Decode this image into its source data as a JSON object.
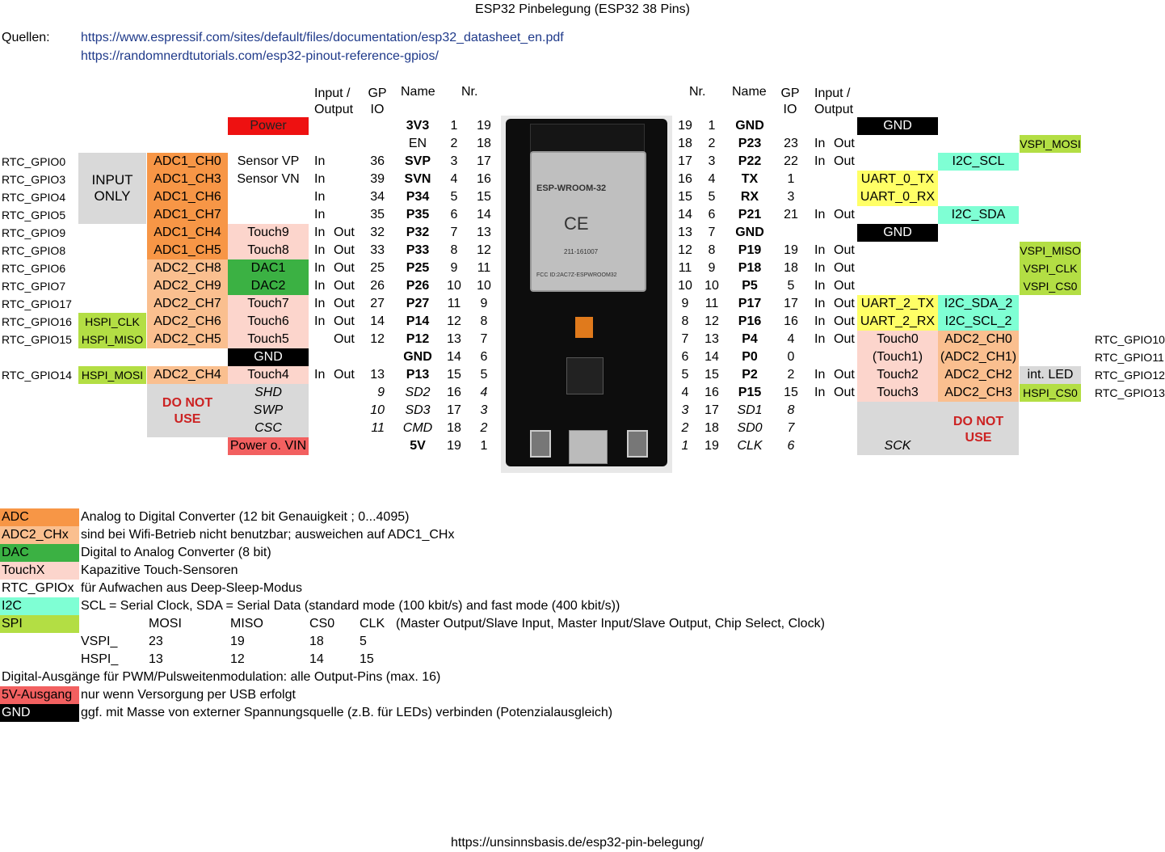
{
  "title": "ESP32 Pinbelegung (ESP32 38 Pins)",
  "sources": {
    "label": "Quellen:",
    "links": [
      "https://www.espressif.com/sites/default/files/documentation/esp32_datasheet_en.pdf",
      "https://randomnerdtutorials.com/esp32-pinout-reference-gpios/"
    ]
  },
  "headers": {
    "io": "Input /",
    "io2": "Output",
    "gp": "GP",
    "gp2": "IO",
    "name": "Name",
    "nr": "Nr."
  },
  "left": {
    "power": "Power",
    "input_only": [
      "INPUT",
      "ONLY"
    ],
    "do_not_use": [
      "DO NOT",
      "USE"
    ],
    "gnd": "GND",
    "power_vin": "Power o. VIN",
    "rows": [
      {
        "rtc": "",
        "spi": "",
        "adc": "",
        "func": "",
        "io": "",
        "gpio": "",
        "name": "3V3",
        "nr": "1",
        "nr2": "19"
      },
      {
        "rtc": "",
        "spi": "",
        "adc": "",
        "func": "",
        "io": "",
        "gpio": "",
        "name": "EN",
        "nr": "2",
        "nr2": "18"
      },
      {
        "rtc": "RTC_GPIO0",
        "spi": "",
        "adc": "ADC1_CH0",
        "func": "Sensor VP",
        "io": "In",
        "out": "",
        "gpio": "36",
        "name": "SVP",
        "nr": "3",
        "nr2": "17"
      },
      {
        "rtc": "RTC_GPIO3",
        "spi": "",
        "adc": "ADC1_CH3",
        "func": "Sensor VN",
        "io": "In",
        "out": "",
        "gpio": "39",
        "name": "SVN",
        "nr": "4",
        "nr2": "16"
      },
      {
        "rtc": "RTC_GPIO4",
        "spi": "",
        "adc": "ADC1_CH6",
        "func": "",
        "io": "In",
        "out": "",
        "gpio": "34",
        "name": "P34",
        "nr": "5",
        "nr2": "15"
      },
      {
        "rtc": "RTC_GPIO5",
        "spi": "",
        "adc": "ADC1_CH7",
        "func": "",
        "io": "In",
        "out": "",
        "gpio": "35",
        "name": "P35",
        "nr": "6",
        "nr2": "14"
      },
      {
        "rtc": "RTC_GPIO9",
        "spi": "",
        "adc": "ADC1_CH4",
        "func": "Touch9",
        "io": "In",
        "out": "Out",
        "gpio": "32",
        "name": "P32",
        "nr": "7",
        "nr2": "13"
      },
      {
        "rtc": "RTC_GPIO8",
        "spi": "",
        "adc": "ADC1_CH5",
        "func": "Touch8",
        "io": "In",
        "out": "Out",
        "gpio": "33",
        "name": "P33",
        "nr": "8",
        "nr2": "12"
      },
      {
        "rtc": "RTC_GPIO6",
        "spi": "",
        "adc": "ADC2_CH8",
        "func": "DAC1",
        "io": "In",
        "out": "Out",
        "gpio": "25",
        "name": "P25",
        "nr": "9",
        "nr2": "11"
      },
      {
        "rtc": "RTC_GPIO7",
        "spi": "",
        "adc": "ADC2_CH9",
        "func": "DAC2",
        "io": "In",
        "out": "Out",
        "gpio": "26",
        "name": "P26",
        "nr": "10",
        "nr2": "10"
      },
      {
        "rtc": "RTC_GPIO17",
        "spi": "",
        "adc": "ADC2_CH7",
        "func": "Touch7",
        "io": "In",
        "out": "Out",
        "gpio": "27",
        "name": "P27",
        "nr": "11",
        "nr2": "9"
      },
      {
        "rtc": "RTC_GPIO16",
        "spi": "HSPI_CLK",
        "adc": "ADC2_CH6",
        "func": "Touch6",
        "io": "In",
        "out": "Out",
        "gpio": "14",
        "name": "P14",
        "nr": "12",
        "nr2": "8"
      },
      {
        "rtc": "RTC_GPIO15",
        "spi": "HSPI_MISO",
        "adc": "ADC2_CH5",
        "func": "Touch5",
        "io": "",
        "out": "Out",
        "gpio": "12",
        "name": "P12",
        "nr": "13",
        "nr2": "7"
      },
      {
        "rtc": "",
        "spi": "",
        "adc": "",
        "func": "",
        "io": "",
        "out": "",
        "gpio": "",
        "name": "GND",
        "nr": "14",
        "nr2": "6"
      },
      {
        "rtc": "RTC_GPIO14",
        "spi": "HSPI_MOSI",
        "adc": "ADC2_CH4",
        "func": "Touch4",
        "io": "In",
        "out": "Out",
        "gpio": "13",
        "name": "P13",
        "nr": "15",
        "nr2": "5"
      },
      {
        "rtc": "",
        "spi": "",
        "adc": "",
        "func": "SHD",
        "io": "",
        "out": "",
        "gpio": "9",
        "name": "SD2",
        "nr": "16",
        "nr2": "4"
      },
      {
        "rtc": "",
        "spi": "",
        "adc": "",
        "func": "SWP",
        "io": "",
        "out": "",
        "gpio": "10",
        "name": "SD3",
        "nr": "17",
        "nr2": "3"
      },
      {
        "rtc": "",
        "spi": "",
        "adc": "",
        "func": "CSC",
        "io": "",
        "out": "",
        "gpio": "11",
        "name": "CMD",
        "nr": "18",
        "nr2": "2"
      },
      {
        "rtc": "",
        "spi": "",
        "adc": "",
        "func": "",
        "io": "",
        "out": "",
        "gpio": "",
        "name": "5V",
        "nr": "19",
        "nr2": "1"
      }
    ]
  },
  "right": {
    "do_not_use": [
      "DO NOT",
      "USE"
    ],
    "sck": "SCK",
    "rows": [
      {
        "nr2": "19",
        "nr": "1",
        "name": "GND",
        "gpio": "",
        "in": "",
        "out": "",
        "uart": "GND",
        "i2c": "",
        "spi": "",
        "rtc": ""
      },
      {
        "nr2": "18",
        "nr": "2",
        "name": "P23",
        "gpio": "23",
        "in": "In",
        "out": "Out",
        "uart": "",
        "i2c": "",
        "spi": "VSPI_MOSI",
        "rtc": ""
      },
      {
        "nr2": "17",
        "nr": "3",
        "name": "P22",
        "gpio": "22",
        "in": "In",
        "out": "Out",
        "uart": "",
        "i2c": "I2C_SCL",
        "spi": "",
        "rtc": ""
      },
      {
        "nr2": "16",
        "nr": "4",
        "name": "TX",
        "gpio": "1",
        "in": "",
        "out": "",
        "uart": "UART_0_TX",
        "i2c": "",
        "spi": "",
        "rtc": ""
      },
      {
        "nr2": "15",
        "nr": "5",
        "name": "RX",
        "gpio": "3",
        "in": "",
        "out": "",
        "uart": "UART_0_RX",
        "i2c": "",
        "spi": "",
        "rtc": ""
      },
      {
        "nr2": "14",
        "nr": "6",
        "name": "P21",
        "gpio": "21",
        "in": "In",
        "out": "Out",
        "uart": "",
        "i2c": "I2C_SDA",
        "spi": "",
        "rtc": ""
      },
      {
        "nr2": "13",
        "nr": "7",
        "name": "GND",
        "gpio": "",
        "in": "",
        "out": "",
        "uart": "GND",
        "i2c": "",
        "spi": "",
        "rtc": ""
      },
      {
        "nr2": "12",
        "nr": "8",
        "name": "P19",
        "gpio": "19",
        "in": "In",
        "out": "Out",
        "uart": "",
        "i2c": "",
        "spi": "VSPI_MISO",
        "rtc": ""
      },
      {
        "nr2": "11",
        "nr": "9",
        "name": "P18",
        "gpio": "18",
        "in": "In",
        "out": "Out",
        "uart": "",
        "i2c": "",
        "spi": "VSPI_CLK",
        "rtc": ""
      },
      {
        "nr2": "10",
        "nr": "10",
        "name": "P5",
        "gpio": "5",
        "in": "In",
        "out": "Out",
        "uart": "",
        "i2c": "",
        "spi": "VSPI_CS0",
        "rtc": ""
      },
      {
        "nr2": "9",
        "nr": "11",
        "name": "P17",
        "gpio": "17",
        "in": "In",
        "out": "Out",
        "uart": "UART_2_TX",
        "i2c": "I2C_SDA_2",
        "spi": "",
        "rtc": ""
      },
      {
        "nr2": "8",
        "nr": "12",
        "name": "P16",
        "gpio": "16",
        "in": "In",
        "out": "Out",
        "uart": "UART_2_RX",
        "i2c": "I2C_SCL_2",
        "spi": "",
        "rtc": ""
      },
      {
        "nr2": "7",
        "nr": "13",
        "name": "P4",
        "gpio": "4",
        "in": "In",
        "out": "Out",
        "uart": "Touch0",
        "i2c": "ADC2_CH0",
        "spi": "",
        "rtc": "RTC_GPIO10"
      },
      {
        "nr2": "6",
        "nr": "14",
        "name": "P0",
        "gpio": "0",
        "in": "",
        "out": "",
        "uart": "(Touch1)",
        "i2c": "(ADC2_CH1)",
        "spi": "",
        "rtc": "RTC_GPIO11"
      },
      {
        "nr2": "5",
        "nr": "15",
        "name": "P2",
        "gpio": "2",
        "in": "In",
        "out": "Out",
        "uart": "Touch2",
        "i2c": "ADC2_CH2",
        "spi": "int. LED",
        "rtc": "RTC_GPIO12"
      },
      {
        "nr2": "4",
        "nr": "16",
        "name": "P15",
        "gpio": "15",
        "in": "In",
        "out": "Out",
        "uart": "Touch3",
        "i2c": "ADC2_CH3",
        "spi": "HSPI_CS0",
        "rtc": "RTC_GPIO13"
      },
      {
        "nr2": "3",
        "nr": "17",
        "name": "SD1",
        "gpio": "8",
        "in": "",
        "out": "",
        "uart": "",
        "i2c": "",
        "spi": "",
        "rtc": ""
      },
      {
        "nr2": "2",
        "nr": "18",
        "name": "SD0",
        "gpio": "7",
        "in": "",
        "out": "",
        "uart": "",
        "i2c": "",
        "spi": "",
        "rtc": ""
      },
      {
        "nr2": "1",
        "nr": "19",
        "name": "CLK",
        "gpio": "6",
        "in": "",
        "out": "",
        "uart": "",
        "i2c": "",
        "spi": "",
        "rtc": ""
      }
    ]
  },
  "board": {
    "module": "ESP-WROOM-32",
    "fcc": "FCC ID:2AC7Z-ESPWROOM32",
    "r": "211-161007"
  },
  "legend": [
    {
      "key": "ADC",
      "text": "Analog to Digital Converter (12 bit Genauigkeit ; 0...4095)",
      "color": "#f79646"
    },
    {
      "key": "ADC2_CHx",
      "text": "sind bei Wifi-Betrieb nicht benutzbar; ausweichen auf ADC1_CHx",
      "color": "#fabf8f"
    },
    {
      "key": "DAC",
      "text": "Digital to Analog Converter (8 bit)",
      "color": "#3bb143"
    },
    {
      "key": "TouchX",
      "text": "Kapazitive Touch-Sensoren",
      "color": "#fcd5cc"
    },
    {
      "key": "RTC_GPIOx",
      "text": "für Aufwachen aus Deep-Sleep-Modus",
      "color": "#ffffff"
    },
    {
      "key": "I2C",
      "text": "SCL = Serial Clock, SDA = Serial Data (standard mode (100 kbit/s) and fast mode (400 kbit/s))",
      "color": "#7fffd4"
    }
  ],
  "spi": {
    "key": "SPI",
    "cols": [
      "MOSI",
      "MISO",
      "CS0",
      "CLK"
    ],
    "desc": "(Master Output/Slave Input, Master Input/Slave Output, Chip Select, Clock)",
    "vspi": {
      "label": "VSPI_",
      "vals": [
        "23",
        "19",
        "18",
        "5"
      ]
    },
    "hspi": {
      "label": "HSPI_",
      "vals": [
        "13",
        "12",
        "14",
        "15"
      ]
    }
  },
  "pwm": "Digital-Ausgänge für PWM/Pulsweitenmodulation: alle Output-Pins (max. 16)",
  "v5": {
    "key": "5V-Ausgang",
    "text": "nur wenn Versorgung per USB erfolgt"
  },
  "gnd": {
    "key": "GND",
    "text": "ggf. mit Masse von externer Spannungsquelle (z.B. für LEDs) verbinden (Potenzialausgleich)"
  },
  "footer": "https://unsinnsbasis.de/esp32-pin-belegung/"
}
